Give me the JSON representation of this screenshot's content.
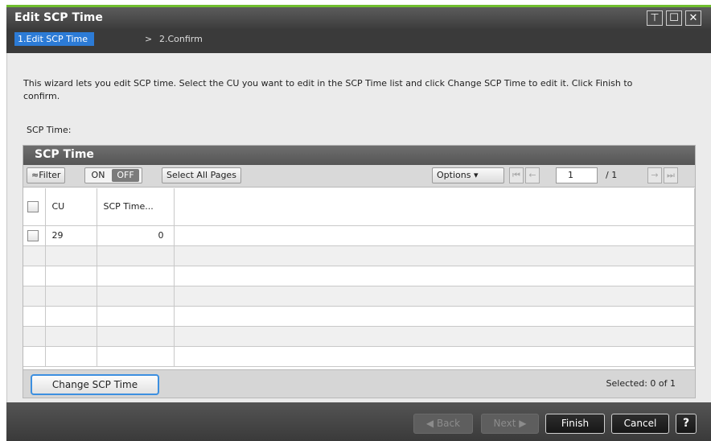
{
  "window": {
    "title": "Edit SCP Time",
    "controls": {
      "pin": "⊤",
      "maximize": "☐",
      "close": "✕"
    }
  },
  "steps": {
    "active": "1.Edit SCP Time",
    "separator": ">",
    "next": "2.Confirm"
  },
  "description": "This wizard lets you edit SCP time. Select the CU you want to edit in the SCP Time list and click Change SCP Time to edit it. Click Finish to confirm.",
  "scp_time_label": "SCP Time:",
  "panel": {
    "title": "SCP Time",
    "toolbar": {
      "filter_label": "≈Filter",
      "on_label": "ON",
      "off_label": "OFF",
      "select_all_label": "Select All Pages",
      "options_label": "Options ▾",
      "page_value": "1",
      "page_total": "/ 1"
    },
    "columns": [
      "CU",
      "SCP Time..."
    ],
    "rows": [
      {
        "cu": "29",
        "scp_time": "0"
      }
    ],
    "empty_rows": 7,
    "change_button": "Change SCP Time",
    "selected_text": "Selected:  0   of 1"
  },
  "footer": {
    "back": "◀ Back",
    "next": "Next ▶",
    "finish": "Finish",
    "cancel": "Cancel",
    "help": "?"
  },
  "colors": {
    "accent_green": "#6fbe2e",
    "step_active": "#2c7bd6",
    "focus_border": "#3c8fe0"
  }
}
